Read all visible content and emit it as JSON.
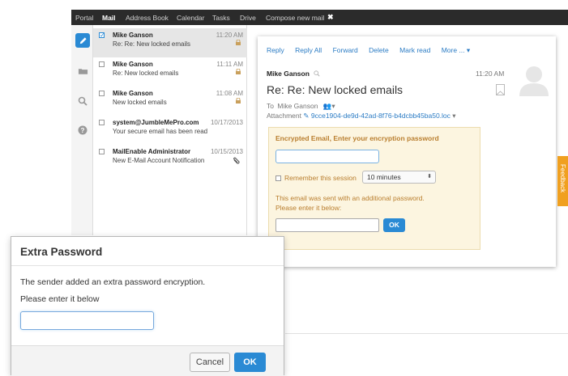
{
  "topbar": {
    "tabs": [
      {
        "label": "Portal",
        "active": false
      },
      {
        "label": "Mail",
        "active": true
      },
      {
        "label": "Address Book",
        "active": false
      },
      {
        "label": "Calendar",
        "active": false
      },
      {
        "label": "Tasks",
        "active": false
      },
      {
        "label": "Drive",
        "active": false
      },
      {
        "label": "Compose new mail",
        "active": false
      }
    ],
    "close_glyph": "✖"
  },
  "sidebar": {
    "icons": [
      "pencil-icon",
      "folder-icon",
      "search-icon",
      "help-icon"
    ]
  },
  "maillist": [
    {
      "from": "Mike Ganson",
      "subject": "Re: Re: New locked emails",
      "time": "11:20 AM",
      "icon": "lock-icon",
      "checked": true,
      "selected": true
    },
    {
      "from": "Mike Ganson",
      "subject": "Re: New locked emails",
      "time": "11:11 AM",
      "icon": "lock-icon",
      "checked": false,
      "selected": false
    },
    {
      "from": "Mike Ganson",
      "subject": "New locked emails",
      "time": "11:08 AM",
      "icon": "lock-icon",
      "checked": false,
      "selected": false
    },
    {
      "from": "system@JumbleMePro.com",
      "subject": "Your secure email has been read",
      "time": "10/17/2013",
      "icon": "",
      "checked": false,
      "selected": false
    },
    {
      "from": "MailEnable Administrator",
      "subject": "New E-Mail Account Notification",
      "time": "10/15/2013",
      "icon": "paperclip-icon",
      "checked": false,
      "selected": false
    }
  ],
  "reader": {
    "actions": [
      "Reply",
      "Reply All",
      "Forward",
      "Delete",
      "Mark read",
      "More ... ▾"
    ],
    "from": "Mike Ganson",
    "time": "11:20 AM",
    "subject": "Re: Re: New locked emails",
    "to_prefix": "To",
    "to": "Mike Ganson",
    "attachment_prefix": "Attachment",
    "attachment": "9cce1904-de9d-42ad-8f76-b4dcbb45ba50.loc",
    "encrypted": {
      "title": "Encrypted Email, Enter your encryption password",
      "remember_label": "Remember this session",
      "remember_value": "10 minutes",
      "note1": "This email was sent with an additional password.",
      "note2": "Please enter it below:",
      "ok_label": "OK"
    }
  },
  "feedback": {
    "label": "Feedback"
  },
  "dialog": {
    "title": "Extra Password",
    "message1": "The sender added an extra password encryption.",
    "message2": "Please enter it below",
    "input_value": "",
    "cancel_label": "Cancel",
    "ok_label": "OK"
  },
  "colors": {
    "accent": "#2a8ad4",
    "topbar": "#2b2b2b",
    "encrypted_text": "#b97e2e",
    "encrypted_bg": "#fcf5e0",
    "feedback": "#f0a020"
  }
}
